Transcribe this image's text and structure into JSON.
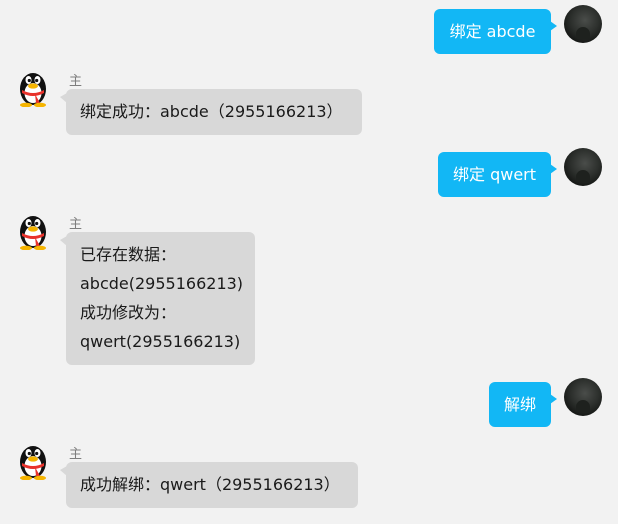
{
  "messages": [
    {
      "side": "right",
      "text": "绑定 abcde"
    },
    {
      "side": "left",
      "sender": "主管",
      "lines": [
        "绑定成功：abcde（2955166213）"
      ]
    },
    {
      "side": "right",
      "text": "绑定 qwert"
    },
    {
      "side": "left",
      "sender": "主管",
      "lines": [
        "已存在数据：",
        "abcde(2955166213)",
        "成功修改为：",
        "qwert(2955166213)"
      ]
    },
    {
      "side": "right",
      "text": "解绑"
    },
    {
      "side": "left",
      "sender": "主管",
      "lines": [
        "成功解绑：qwert（2955166213）"
      ]
    }
  ],
  "colors": {
    "background": "#f2f2f2",
    "user_bubble": "#12b7f5",
    "bot_bubble": "#d8d8d8",
    "sender_name": "#7d7d7d"
  },
  "icons": {
    "user_avatar": "dark-photo-avatar-icon",
    "bot_avatar": "qq-penguin-avatar-icon"
  }
}
